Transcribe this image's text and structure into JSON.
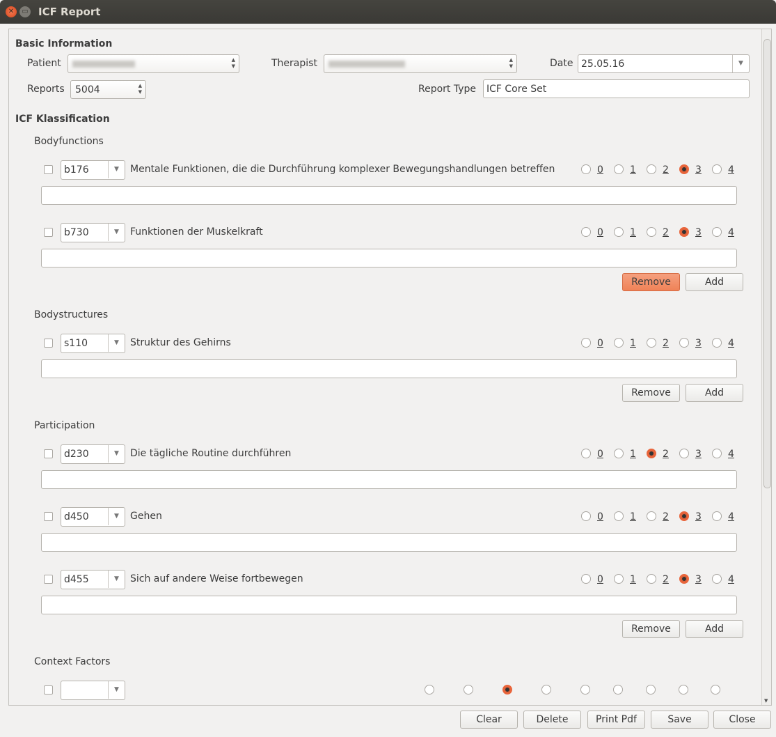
{
  "window": {
    "title": "ICF Report"
  },
  "basic": {
    "heading": "Basic Information",
    "patient_label": "Patient",
    "therapist_label": "Therapist",
    "date_label": "Date",
    "date_value": "25.05.16",
    "reports_label": "Reports",
    "reports_value": "5004",
    "report_type_label": "Report Type",
    "report_type_value": "ICF Core Set"
  },
  "icf": {
    "heading": "ICF Klassification",
    "remove_label": "Remove",
    "add_label": "Add",
    "scale": [
      "0",
      "1",
      "2",
      "3",
      "4"
    ],
    "sections": [
      {
        "title": "Bodyfunctions",
        "items": [
          {
            "code": "b176",
            "text": "Mentale Funktionen, die die Durchführung komplexer Bewegungshandlungen betreffen",
            "selected": 3,
            "checked": false,
            "note": ""
          },
          {
            "code": "b730",
            "text": "Funktionen der Muskelkraft",
            "selected": 3,
            "checked": false,
            "note": ""
          }
        ]
      },
      {
        "title": "Bodystructures",
        "items": [
          {
            "code": "s110",
            "text": "Struktur des Gehirns",
            "selected": null,
            "checked": false,
            "note": ""
          }
        ]
      },
      {
        "title": "Participation",
        "items": [
          {
            "code": "d230",
            "text": "Die tägliche Routine durchführen",
            "selected": 2,
            "checked": false,
            "note": ""
          },
          {
            "code": "d450",
            "text": "Gehen",
            "selected": 3,
            "checked": false,
            "note": ""
          },
          {
            "code": "d455",
            "text": "Sich auf andere Weise fortbewegen",
            "selected": 3,
            "checked": false,
            "note": ""
          }
        ]
      },
      {
        "title": "Context Factors",
        "items": []
      }
    ]
  },
  "footer": {
    "clear": "Clear",
    "delete": "Delete",
    "print": "Print Pdf",
    "save": "Save",
    "close": "Close"
  },
  "colors": {
    "accent": "#e9653b",
    "hover_button": "#f08a60"
  }
}
